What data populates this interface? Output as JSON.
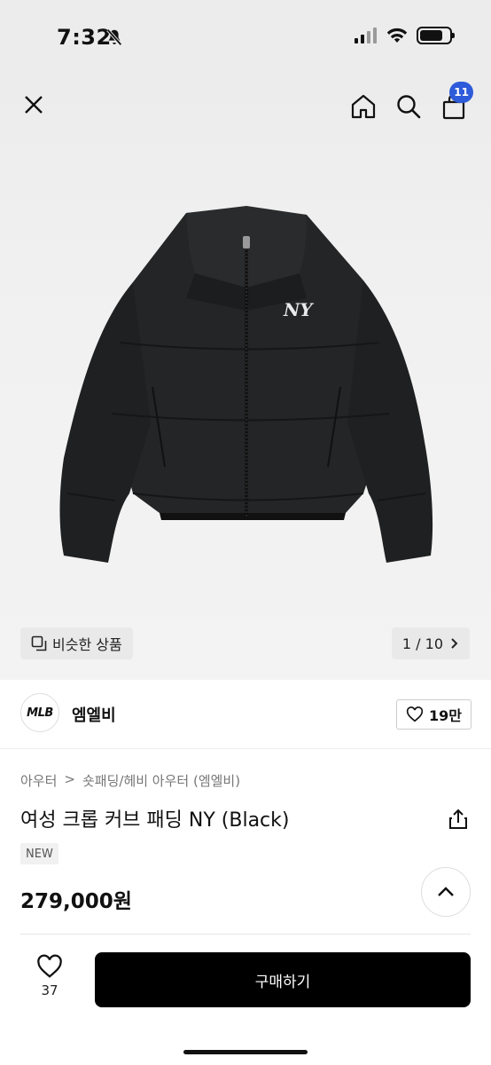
{
  "status_bar": {
    "time": "7:32"
  },
  "header": {
    "cart_count": "11"
  },
  "gallery": {
    "similar_label": "비슷한 상품",
    "page_indicator": "1 / 10"
  },
  "brand": {
    "logo_text": "MLB",
    "name": "엠엘비",
    "likes": "19만"
  },
  "product": {
    "breadcrumb": [
      "아우터",
      "숏패딩/헤비 아우터 (엠엘비)"
    ],
    "title": "여성 크롭 커브 패딩 NY (Black)",
    "badge": "NEW",
    "price": "279,000원"
  },
  "bottom_bar": {
    "wish_count": "37",
    "buy_label": "구매하기"
  },
  "colors": {
    "badge_blue": "#2d5bd9",
    "buy_button": "#000000"
  }
}
